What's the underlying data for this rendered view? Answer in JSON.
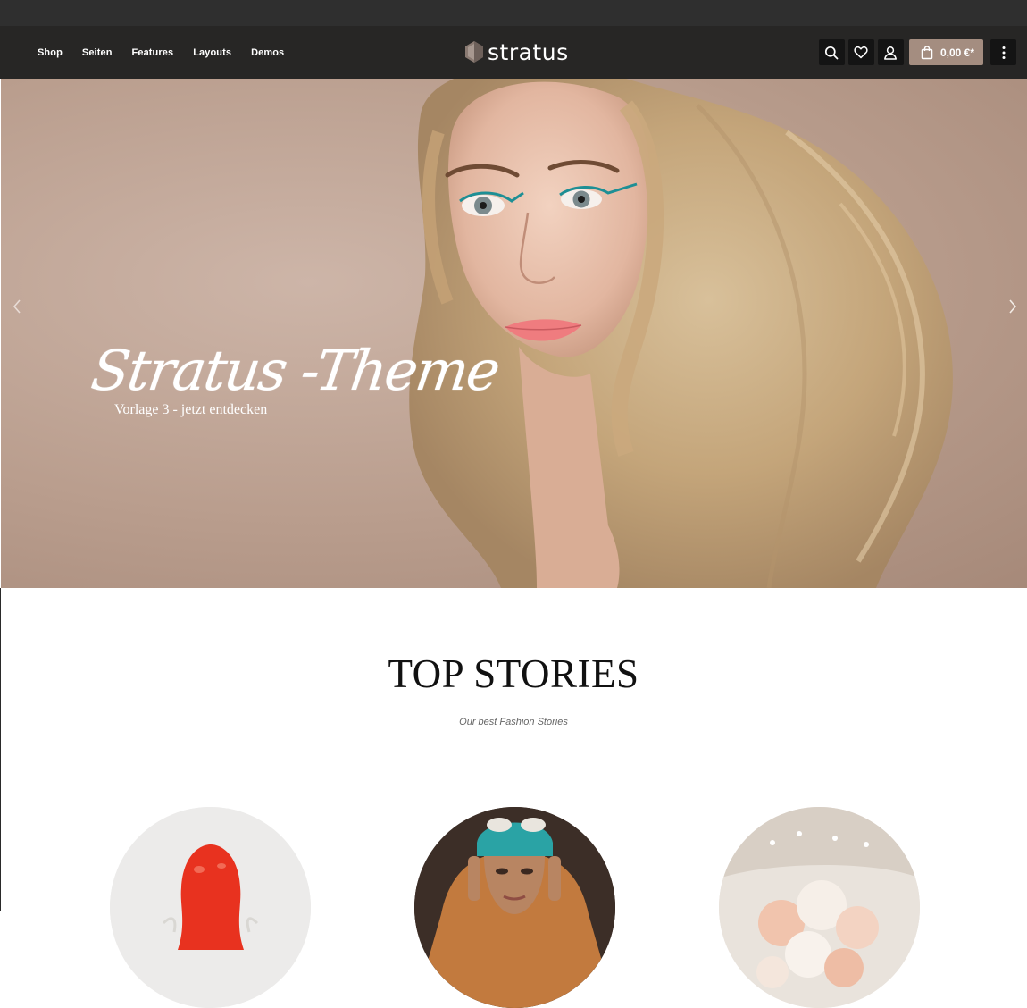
{
  "nav": {
    "items": [
      "Shop",
      "Seiten",
      "Features",
      "Layouts",
      "Demos"
    ]
  },
  "brand": {
    "name": "stratus",
    "logo_icon": "hexagon-logo-icon"
  },
  "toolbar": {
    "search_icon": "search-icon",
    "wishlist_icon": "heart-icon",
    "account_icon": "user-icon",
    "cart_icon": "shopping-bag-icon",
    "cart_total": "0,00 €*",
    "menu_icon": "more-vertical-icon"
  },
  "hero": {
    "title": "Stratus -Theme",
    "subtitle": "Vorlage 3 - jetzt entdecken",
    "prev_icon": "chevron-left-icon",
    "next_icon": "chevron-right-icon"
  },
  "stories": {
    "heading": "TOP STORIES",
    "subheading": "Our best Fashion Stories"
  },
  "colors": {
    "header_bg": "#272625",
    "accent": "#a48d80",
    "hero_bg": "#b99d8d"
  }
}
